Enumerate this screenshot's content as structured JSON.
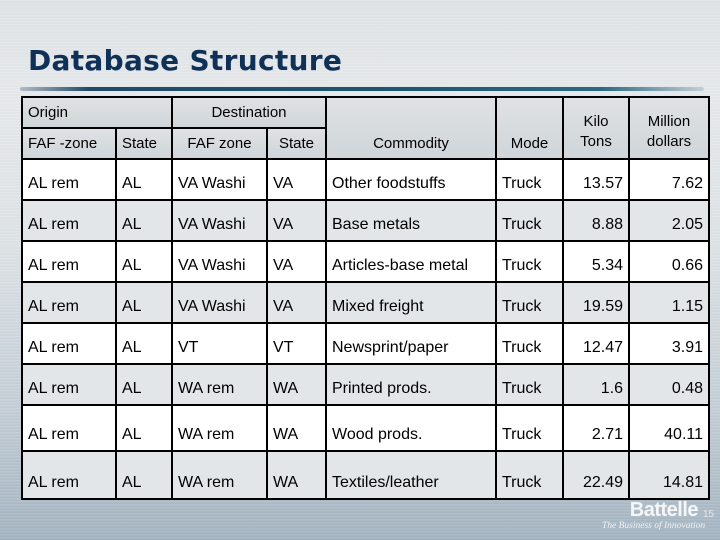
{
  "slide": {
    "title": "Database Structure",
    "page_number": "15"
  },
  "logo": {
    "name": "Battelle",
    "tagline": "The Business of Innovation"
  },
  "table": {
    "group_headers": {
      "origin": "Origin",
      "destination": "Destination"
    },
    "columns": {
      "origin_faf_zone": "FAF -zone",
      "origin_state": "State",
      "dest_faf_zone": "FAF zone",
      "dest_state": "State",
      "commodity": "Commodity",
      "mode": "Mode",
      "kilo_tons": "Kilo Tons",
      "million_dollars": "Million dollars"
    },
    "rows": [
      {
        "origin_faf_zone": "AL rem",
        "origin_state": "AL",
        "dest_faf_zone": "VA Washi",
        "dest_state": "VA",
        "commodity": "Other foodstuffs",
        "mode": "Truck",
        "kilo_tons": "13.57",
        "million_dollars": "7.62"
      },
      {
        "origin_faf_zone": "AL rem",
        "origin_state": "AL",
        "dest_faf_zone": "VA Washi",
        "dest_state": "VA",
        "commodity": "Base metals",
        "mode": "Truck",
        "kilo_tons": "8.88",
        "million_dollars": "2.05"
      },
      {
        "origin_faf_zone": "AL rem",
        "origin_state": "AL",
        "dest_faf_zone": "VA Washi",
        "dest_state": "VA",
        "commodity": "Articles-base metal",
        "mode": "Truck",
        "kilo_tons": "5.34",
        "million_dollars": "0.66"
      },
      {
        "origin_faf_zone": "AL rem",
        "origin_state": "AL",
        "dest_faf_zone": "VA Washi",
        "dest_state": "VA",
        "commodity": "Mixed freight",
        "mode": "Truck",
        "kilo_tons": "19.59",
        "million_dollars": "1.15"
      },
      {
        "origin_faf_zone": "AL rem",
        "origin_state": "AL",
        "dest_faf_zone": "VT",
        "dest_state": "VT",
        "commodity": "Newsprint/paper",
        "mode": "Truck",
        "kilo_tons": "12.47",
        "million_dollars": "3.91"
      },
      {
        "origin_faf_zone": "AL rem",
        "origin_state": "AL",
        "dest_faf_zone": "WA rem",
        "dest_state": "WA",
        "commodity": "Printed prods.",
        "mode": "Truck",
        "kilo_tons": "1.6",
        "million_dollars": "0.48"
      },
      {
        "origin_faf_zone": "AL rem",
        "origin_state": "AL",
        "dest_faf_zone": "WA rem",
        "dest_state": "WA",
        "commodity": "Wood prods.",
        "mode": "Truck",
        "kilo_tons": "2.71",
        "million_dollars": "40.11"
      },
      {
        "origin_faf_zone": "AL rem",
        "origin_state": "AL",
        "dest_faf_zone": "WA rem",
        "dest_state": "WA",
        "commodity": "Textiles/leather",
        "mode": "Truck",
        "kilo_tons": "22.49",
        "million_dollars": "14.81"
      }
    ]
  }
}
